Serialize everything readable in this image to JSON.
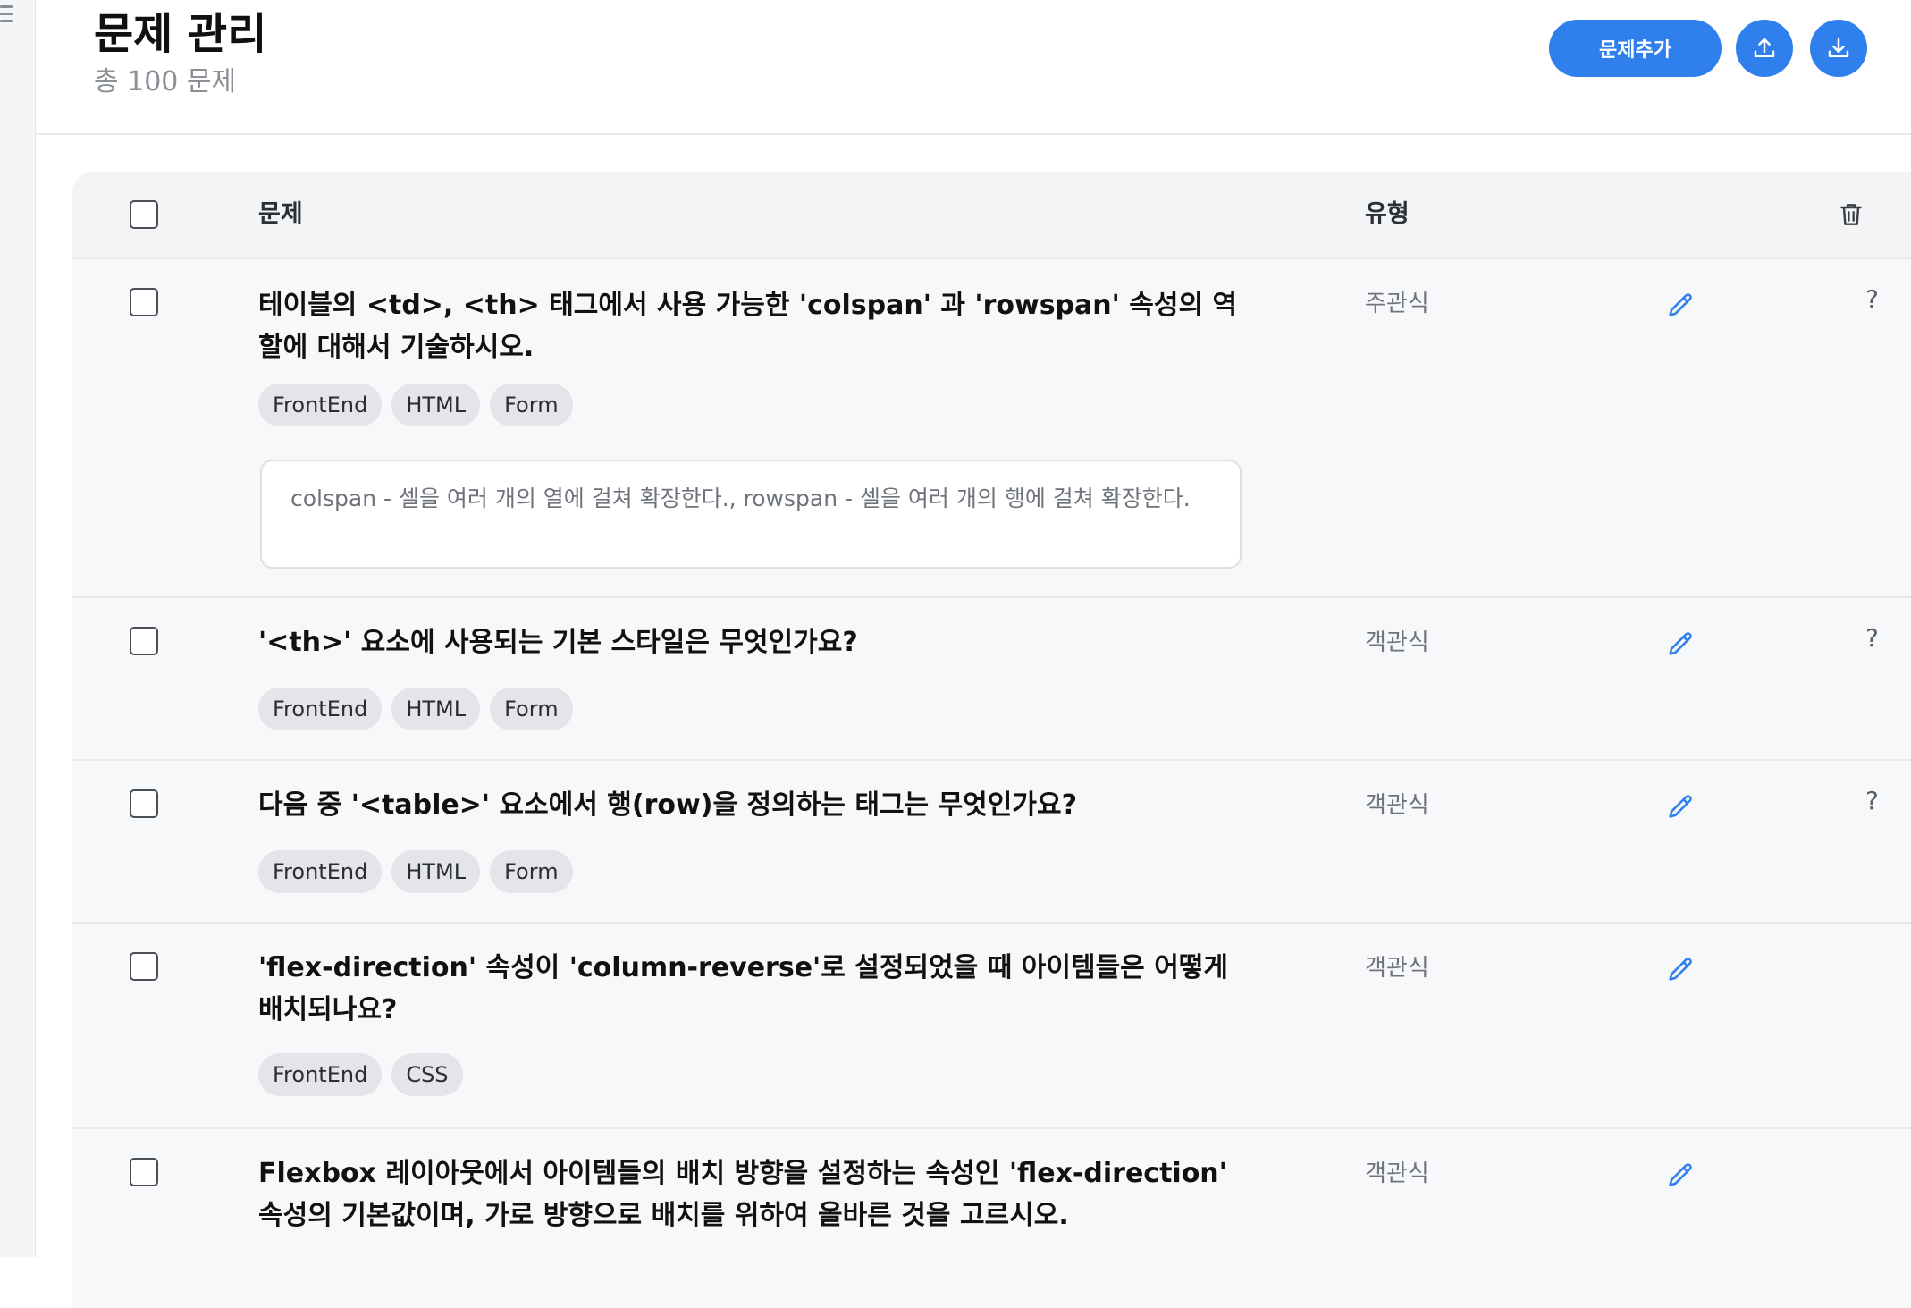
{
  "header": {
    "title": "문제 관리",
    "subtitle": "총 100 문제",
    "add_button_label": "문제추가",
    "upload_icon": "upload-icon",
    "download_icon": "download-icon"
  },
  "table": {
    "col_question": "문제",
    "col_type": "유형",
    "delete_icon": "trash-icon"
  },
  "rows": [
    {
      "question": "테이블의 <td>, <th> 태그에서 사용 가능한 'colspan' 과 'rowspan' 속성의 역할에 대해서 기술하시오.",
      "type": "주관식",
      "tags": [
        "FrontEnd",
        "HTML",
        "Form"
      ],
      "answer": "colspan - 셀을 여러 개의 열에 걸쳐 확장한다., rowspan - 셀을 여러 개의 행에 걸쳐 확장한다.",
      "help": "?"
    },
    {
      "question": "'<th>' 요소에 사용되는 기본 스타일은 무엇인가요?",
      "type": "객관식",
      "tags": [
        "FrontEnd",
        "HTML",
        "Form"
      ],
      "help": "?"
    },
    {
      "question": "다음 중 '<table>' 요소에서 행(row)을 정의하는 태그는 무엇인가요?",
      "type": "객관식",
      "tags": [
        "FrontEnd",
        "HTML",
        "Form"
      ],
      "help": "?"
    },
    {
      "question": "'flex-direction' 속성이 'column-reverse'로 설정되었을 때 아이템들은 어떻게 배치되나요?",
      "type": "객관식",
      "tags": [
        "FrontEnd",
        "CSS"
      ]
    },
    {
      "question": "Flexbox 레이아웃에서 아이템들의 배치 방향을 설정하는 속성인 'flex-direction' 속성의 기본값이며, 가로 방향으로 배치를 위하여 올바른 것을 고르시오.",
      "type": "객관식",
      "tags": []
    }
  ],
  "colors": {
    "accent": "#2f80ed",
    "row_bg": "#f7f8fa",
    "tag_bg": "#e4e5e8"
  }
}
